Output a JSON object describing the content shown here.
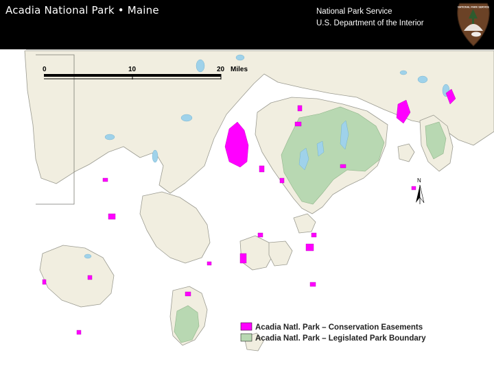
{
  "header": {
    "title": "Acadia National Park  •  Maine",
    "agency": "National Park Service",
    "department": "U.S. Department of the Interior"
  },
  "badge": {
    "icon": "nps-arrowhead-icon",
    "text": "NATIONAL PARK SERVICE"
  },
  "scale_bar": {
    "ticks": [
      "0",
      "10",
      "20"
    ],
    "unit": "Miles"
  },
  "north_arrow": {
    "label": "N"
  },
  "legend": {
    "items": [
      {
        "label": "Acadia Natl. Park – Conservation Easements",
        "color": "#ff00ff"
      },
      {
        "label": "Acadia Natl. Park – Legislated Park Boundary",
        "color": "#b8d8b2"
      }
    ]
  },
  "colors": {
    "land": "#f1eee0",
    "water": "#9fd2ea",
    "park_boundary": "#b8d8b2",
    "easement": "#ff00ff",
    "header_bg": "#000000",
    "badge_brown": "#6b4226"
  }
}
